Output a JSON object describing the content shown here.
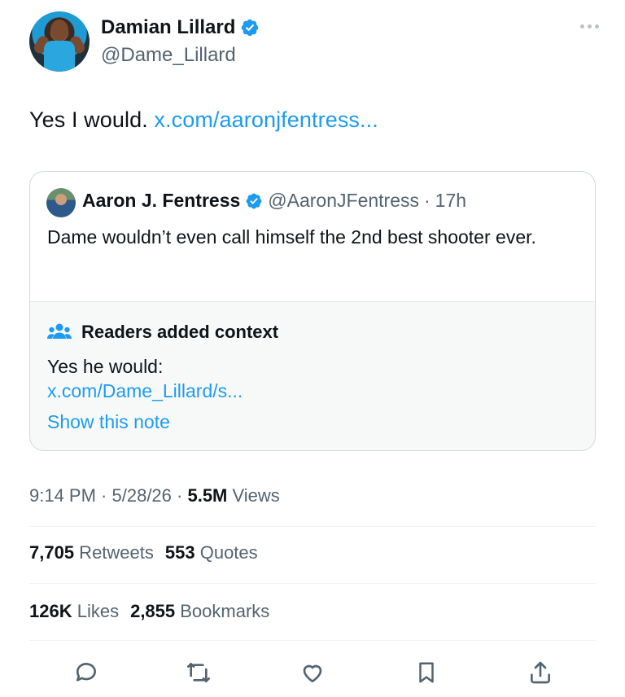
{
  "author": {
    "name": "Damian Lillard",
    "handle": "@Dame_Lillard"
  },
  "tweet": {
    "text": "Yes I would. ",
    "link": "x.com/aaronjfentress..."
  },
  "quote": {
    "name": "Aaron J. Fentress",
    "handle": "@AaronJFentress",
    "sep": "·",
    "time": "17h",
    "body": "Dame wouldn’t even call himself the 2nd best shooter ever."
  },
  "note": {
    "title": "Readers added context",
    "text": "Yes he would:",
    "link": "x.com/Dame_Lillard/s...",
    "show": "Show this note"
  },
  "meta": {
    "time": "9:14 PM",
    "sep1": " · ",
    "date": "5/28/26",
    "sep2": " · ",
    "views_count": "5.5M",
    "views_label": " Views"
  },
  "stats": {
    "retweets_count": "7,705",
    "retweets_label": " Retweets",
    "quotes_count": "553",
    "quotes_label": " Quotes",
    "likes_count": "126K",
    "likes_label": " Likes",
    "bookmarks_count": "2,855",
    "bookmarks_label": " Bookmarks"
  },
  "colors": {
    "accent": "#1d9bf0",
    "text": "#0f1419",
    "secondary": "#536471",
    "border": "#cfd9de"
  },
  "icons": {
    "verified": "verified-badge-icon",
    "more": "more-icon",
    "readers": "people-icon",
    "reply": "reply-icon",
    "retweet": "retweet-icon",
    "like": "heart-icon",
    "bookmark": "bookmark-icon",
    "share": "share-icon"
  }
}
